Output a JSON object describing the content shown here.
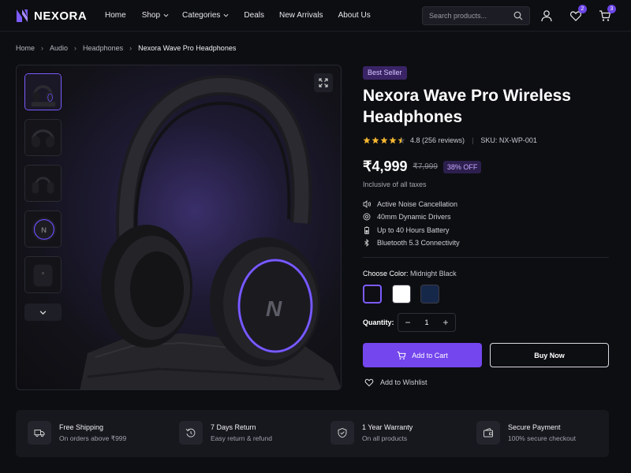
{
  "brand": {
    "name": "NEXORA",
    "accent": "#7446ee"
  },
  "nav": {
    "items": [
      {
        "label": "Home",
        "dropdown": false
      },
      {
        "label": "Shop",
        "dropdown": true
      },
      {
        "label": "Categories",
        "dropdown": true
      },
      {
        "label": "Deals",
        "dropdown": false
      },
      {
        "label": "New Arrivals",
        "dropdown": false
      },
      {
        "label": "About Us",
        "dropdown": false
      }
    ]
  },
  "search": {
    "placeholder": "Search products..."
  },
  "header_icons": {
    "wishlist_count": "2",
    "cart_count": "3"
  },
  "breadcrumb": [
    "Home",
    "Audio",
    "Headphones",
    "Nexora Wave Pro Headphones"
  ],
  "product": {
    "tag": "Best Seller",
    "title": "Nexora Wave Pro Wireless Headphones",
    "rating": "4.8",
    "rating_stars": 4.5,
    "reviews": "(256 reviews)",
    "sku": "SKU: NX-WP-001",
    "price": "₹4,999",
    "mrp": "₹7,999",
    "discount": "38% OFF",
    "tax_note": "Inclusive of all taxes",
    "features": [
      {
        "icon": "noise-cancel-icon",
        "label": "Active Noise Cancellation"
      },
      {
        "icon": "driver-icon",
        "label": "40mm Dynamic Drivers"
      },
      {
        "icon": "battery-icon",
        "label": "Up to 40 Hours Battery"
      },
      {
        "icon": "bluetooth-icon",
        "label": "Bluetooth 5.3 Connectivity"
      }
    ],
    "color_label": "Choose Color:",
    "color_selected": "Midnight Black",
    "colors": [
      {
        "name": "Midnight Black",
        "hex": "#0e0e14",
        "selected": true
      },
      {
        "name": "White",
        "hex": "#ffffff",
        "selected": false
      },
      {
        "name": "Navy",
        "hex": "#16284a",
        "selected": false
      }
    ],
    "quantity_label": "Quantity:",
    "quantity": "1",
    "add_to_cart": "Add to Cart",
    "buy_now": "Buy Now",
    "wishlist": "Add to Wishlist"
  },
  "perks": [
    {
      "icon": "truck-icon",
      "title": "Free Shipping",
      "sub": "On orders above ₹999"
    },
    {
      "icon": "return-icon",
      "title": "7 Days Return",
      "sub": "Easy return & refund"
    },
    {
      "icon": "shield-icon",
      "title": "1 Year Warranty",
      "sub": "On all products"
    },
    {
      "icon": "wallet-icon",
      "title": "Secure Payment",
      "sub": "100% secure checkout"
    }
  ]
}
